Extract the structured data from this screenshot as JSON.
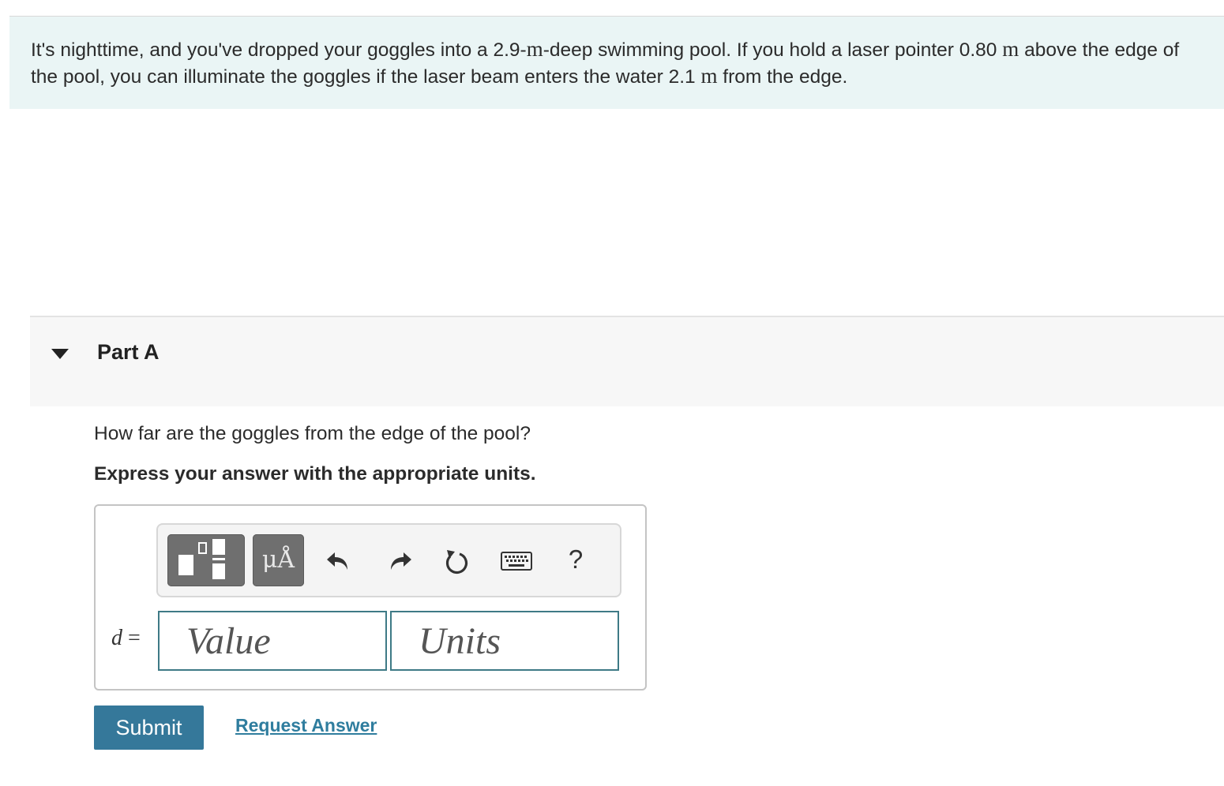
{
  "problem": {
    "text_1": "It's nighttime, and you've dropped your goggles into a 2.9-",
    "unit_1": "m",
    "text_2": "-deep swimming pool. If you hold a laser pointer 0.80 ",
    "unit_2": "m",
    "text_3": " above the edge of the pool, you can illuminate the goggles if the laser beam enters the water 2.1 ",
    "unit_3": "m",
    "text_4": " from the edge."
  },
  "part": {
    "title": "Part A",
    "expanded": true,
    "question": "How far are the goggles from the edge of the pool?",
    "instruction": "Express your answer with the appropriate units."
  },
  "toolbar": {
    "templates_icon": "templates-icon",
    "units_label": "μÅ",
    "undo_icon": "undo-icon",
    "redo_icon": "redo-icon",
    "reset_icon": "reset-icon",
    "keyboard_icon": "keyboard-icon",
    "help_label": "?"
  },
  "answer": {
    "variable": "d",
    "equals": "=",
    "value_placeholder": "Value",
    "value": "",
    "units_placeholder": "Units",
    "units": ""
  },
  "actions": {
    "submit_label": "Submit",
    "request_answer_label": "Request Answer"
  },
  "colors": {
    "intro_background": "#eaf5f5",
    "part_header_background": "#f7f7f7",
    "submit_background": "#35789a",
    "link": "#2f7d9e",
    "input_border": "#3e7a86",
    "toolbar_button": "#6f6f6f"
  }
}
